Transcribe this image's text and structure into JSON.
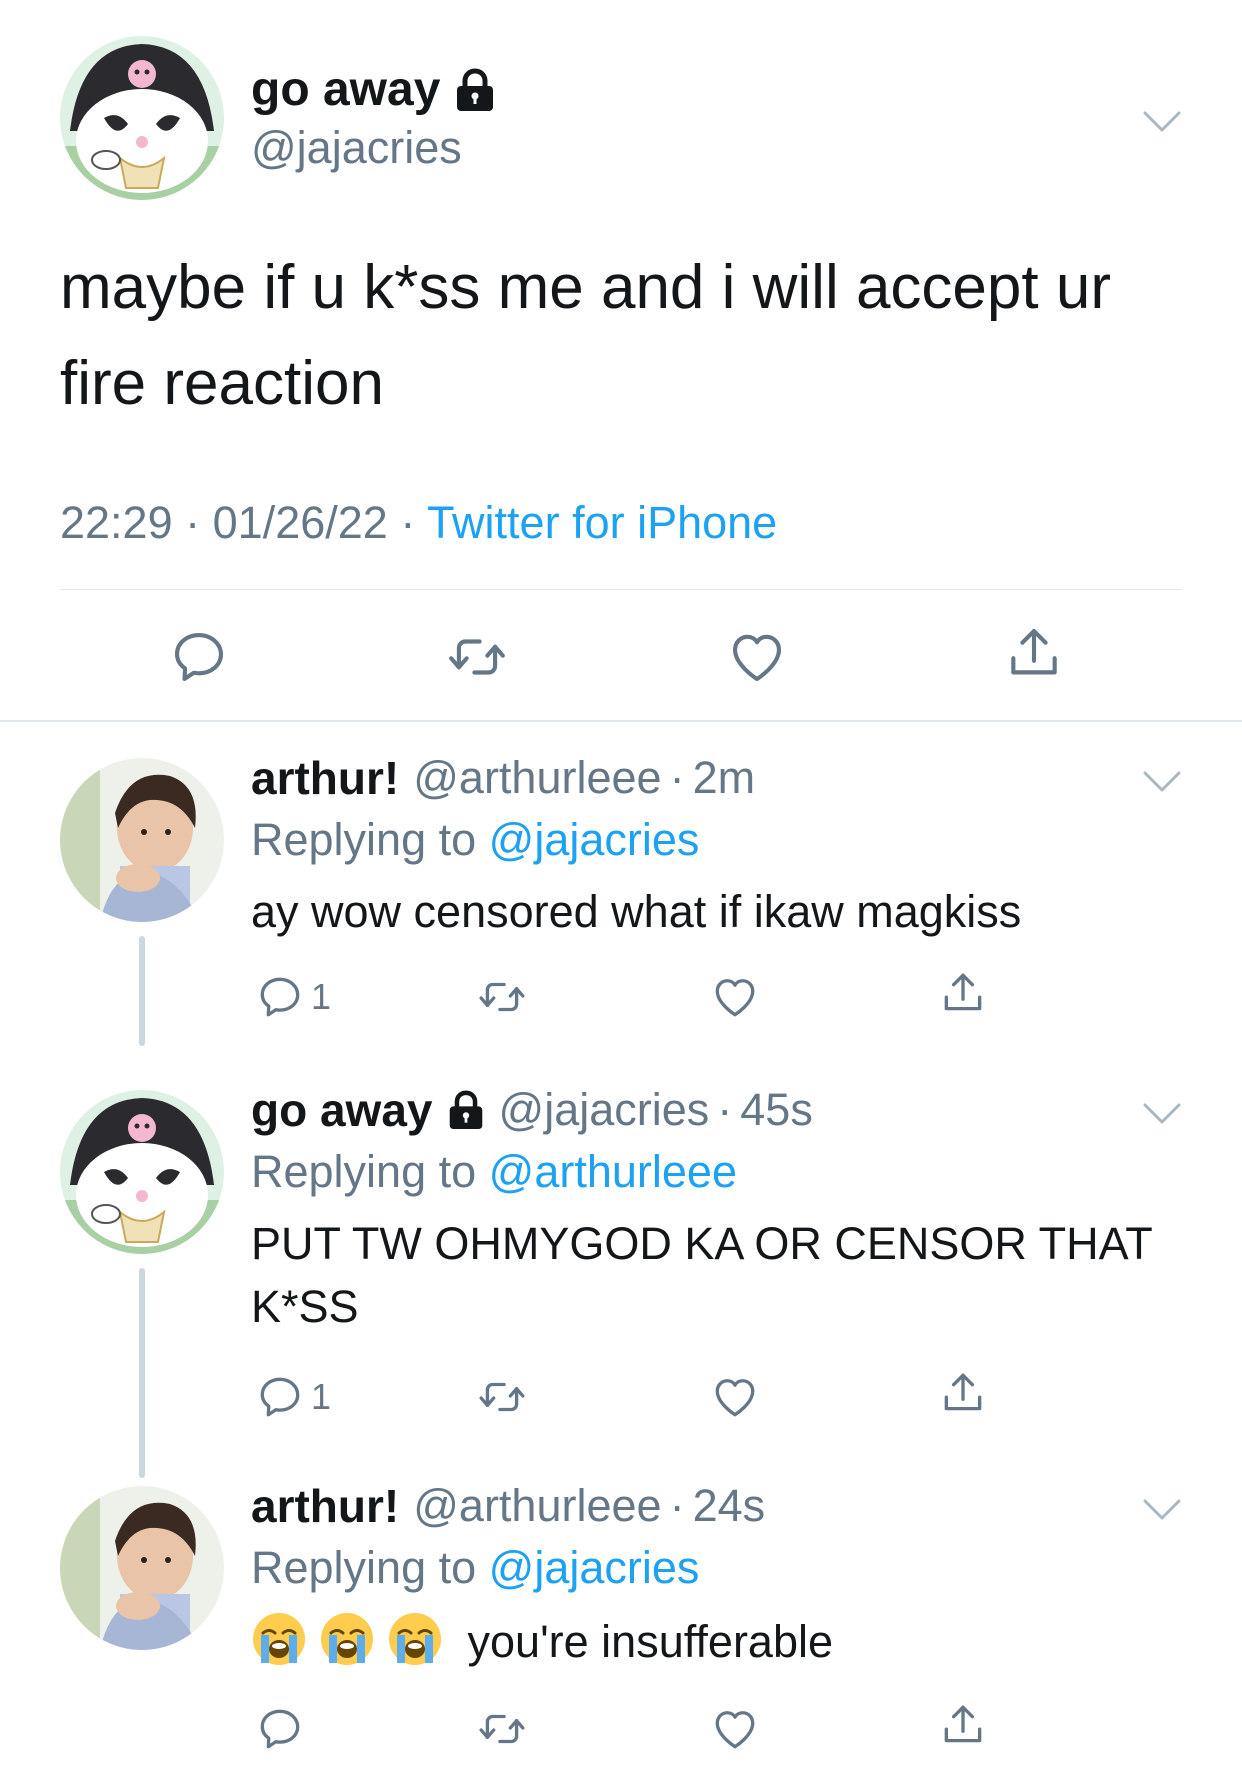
{
  "main_tweet": {
    "display_name": "go away",
    "handle": "@jajacries",
    "text": "maybe if u k*ss me and i will accept ur fire reaction",
    "time": "22:29",
    "date": "01/26/22",
    "separator": "·",
    "source": "Twitter for iPhone"
  },
  "replies": [
    {
      "display_name": "arthur!",
      "handle": "@arthurleee",
      "time": "2m",
      "replying_prefix": "Replying to",
      "replying_to": "@jajacries",
      "text": "ay wow censored what if ikaw magkiss",
      "reply_count": "1"
    },
    {
      "display_name": "go away",
      "handle": "@jajacries",
      "time": "45s",
      "replying_prefix": "Replying to",
      "replying_to": "@arthurleee",
      "text": "PUT TW OHMYGOD KA OR CENSOR THAT K*SS",
      "reply_count": "1"
    },
    {
      "display_name": "arthur!",
      "handle": "@arthurleee",
      "time": "24s",
      "replying_prefix": "Replying to",
      "replying_to": "@jajacries",
      "text": "you're insufferable",
      "emojis": [
        "loudly-crying-face",
        "loudly-crying-face",
        "loudly-crying-face"
      ],
      "reply_count": ""
    }
  ],
  "colors": {
    "text": "#14171a",
    "secondary": "#657786",
    "link": "#1da1f2",
    "divider": "#e1e8ed",
    "thread_line": "#ccd6dd"
  },
  "icons": {
    "reply": "reply-icon",
    "retweet": "retweet-icon",
    "like": "heart-icon",
    "share": "share-icon",
    "lock": "lock-icon",
    "menu": "chevron-down-icon"
  }
}
